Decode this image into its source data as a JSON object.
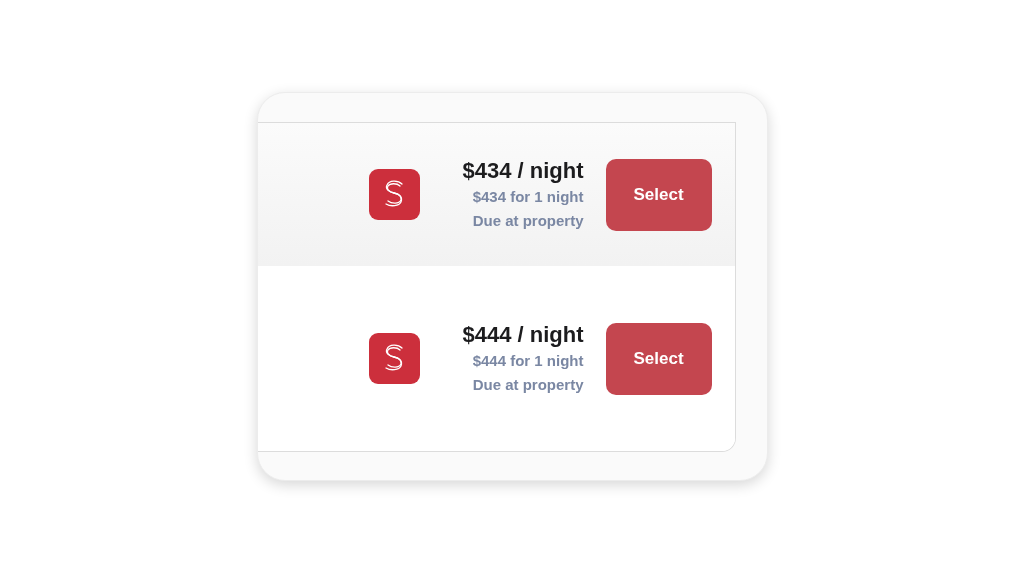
{
  "rates": [
    {
      "price": "$434 / night",
      "total": "$434 for 1 night",
      "payment": "Due at property",
      "button": "Select",
      "highlighted": true
    },
    {
      "price": "$444 / night",
      "total": "$444 for 1 night",
      "payment": "Due at property",
      "button": "Select",
      "highlighted": false
    }
  ]
}
